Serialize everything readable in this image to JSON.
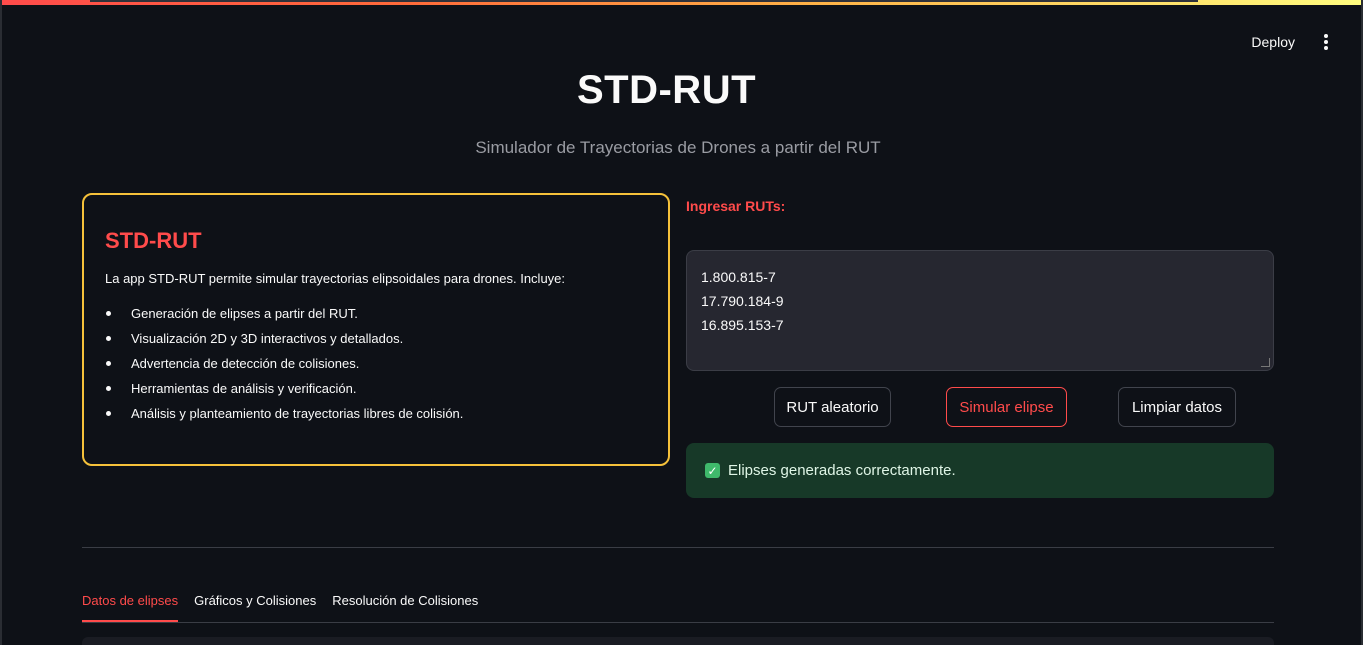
{
  "header": {
    "deploy_label": "Deploy",
    "menu_icon": "vertical-ellipsis-icon"
  },
  "app": {
    "title": "STD-RUT",
    "subtitle": "Simulador de Trayectorias de Drones a partir del RUT"
  },
  "info_card": {
    "heading": "STD-RUT",
    "description": "La app STD-RUT permite simular trayectorias elipsoidales para drones. Incluye:",
    "features": [
      "Generación de elipses a partir del RUT.",
      "Visualización 2D y 3D interactivos y detallados.",
      "Advertencia de detección de colisiones.",
      "Herramientas de análisis y verificación.",
      "Análisis y planteamiento de trayectorias libres de colisión."
    ],
    "border_color": "#f5c13a"
  },
  "rut_input": {
    "label": "Ingresar RUTs:",
    "lines": [
      "1.800.815-7",
      "17.790.184-9",
      "16.895.153-7"
    ]
  },
  "buttons": {
    "random": "RUT aleatorio",
    "simulate": "Simular elipse",
    "clear": "Limpiar datos"
  },
  "status": {
    "icon": "check-box-icon",
    "message": "Elipses generadas correctamente."
  },
  "tabs": [
    {
      "label": "Datos de elipses",
      "active": true
    },
    {
      "label": "Gráficos y Colisiones",
      "active": false
    },
    {
      "label": "Resolución de Colisiones",
      "active": false
    }
  ],
  "colors": {
    "accent": "#ff4b4b",
    "background": "#0e1117",
    "success_bg": "#173928"
  }
}
